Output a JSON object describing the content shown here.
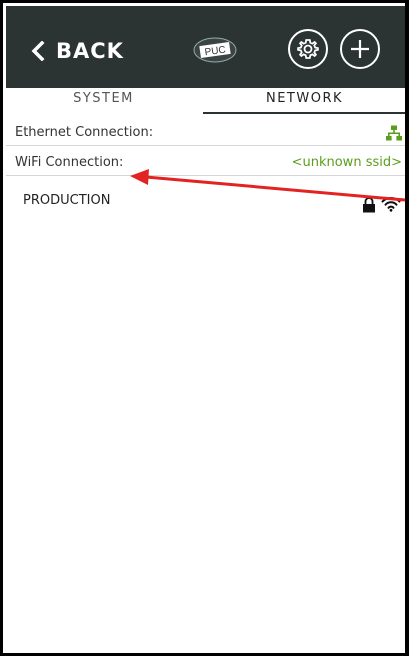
{
  "header": {
    "back_label": "BACK",
    "logo_text": "PUC",
    "background": "#2b3433"
  },
  "tabs": [
    {
      "label": "SYSTEM",
      "active": false
    },
    {
      "label": "NETWORK",
      "active": true
    }
  ],
  "status_rows": [
    {
      "label": "Ethernet Connection:",
      "value_icon": "network-connected-icon",
      "value_color": "#5a9e1c"
    },
    {
      "label": "WiFi Connection:",
      "value": "<unknown ssid>",
      "value_color": "#5a9e1c"
    }
  ],
  "networks": [
    {
      "ssid": "PRODUCTION",
      "secured": true,
      "icons": [
        "lock-icon",
        "wifi-icon"
      ]
    }
  ],
  "annotation": {
    "type": "arrow",
    "color": "#e32222"
  },
  "colors": {
    "accent": "#5a9e1c",
    "annotation": "#e32222"
  }
}
